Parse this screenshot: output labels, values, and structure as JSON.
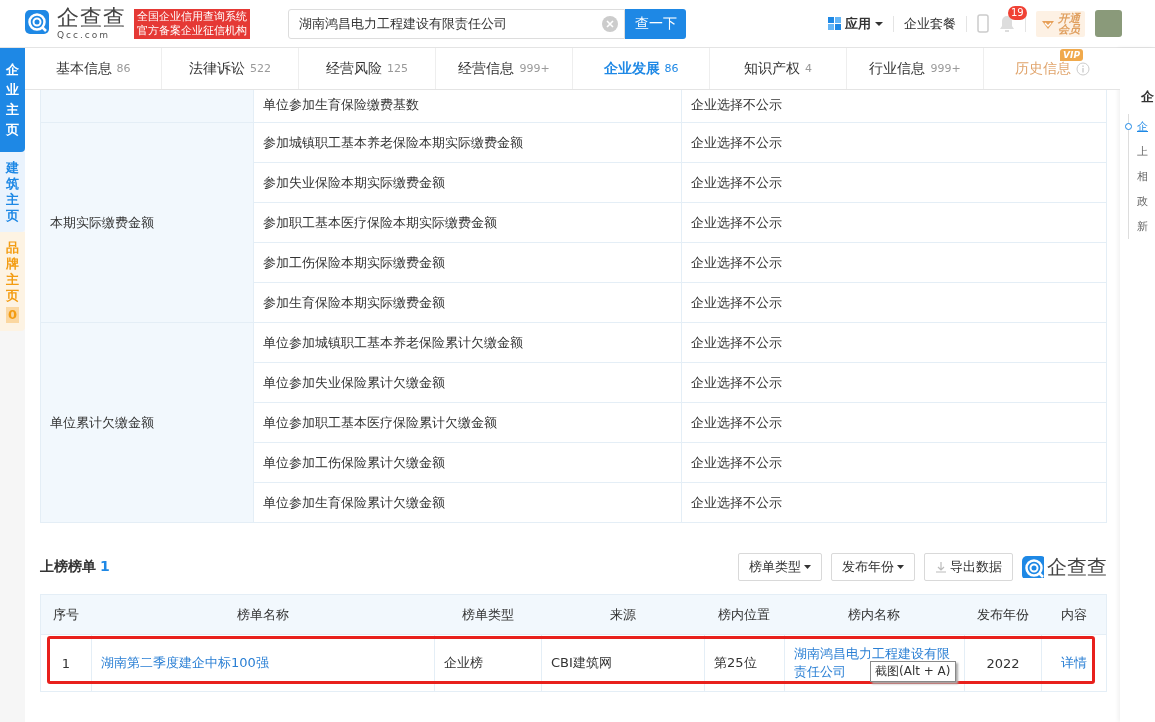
{
  "header": {
    "logo_text": "企查查",
    "logo_sub": "Qcc.com",
    "badge_lines": [
      "全国企业信用查询系统",
      "官方备案企业征信机构"
    ],
    "search": {
      "value": "湖南鸿昌电力工程建设有限责任公司"
    },
    "search_button": "查一下",
    "apps": "应用",
    "package": "企业套餐",
    "notifications": "19",
    "vip": [
      "开通",
      "会员"
    ]
  },
  "side_tabs": [
    {
      "label": "企业主页",
      "selected": true,
      "color": "#1e88e5"
    },
    {
      "label": "建筑主页",
      "selected": false,
      "color": "#1e88e5"
    },
    {
      "label": "品牌主页",
      "selected": false,
      "color": "#f39c12",
      "count": "0"
    }
  ],
  "tabs": [
    {
      "label": "基本信息",
      "count": "86",
      "selected": false,
      "kind": "normal"
    },
    {
      "label": "法律诉讼",
      "count": "522",
      "selected": false,
      "kind": "normal"
    },
    {
      "label": "经营风险",
      "count": "125",
      "selected": false,
      "kind": "normal"
    },
    {
      "label": "经营信息",
      "count": "999+",
      "selected": false,
      "kind": "normal"
    },
    {
      "label": "企业发展",
      "count": "86",
      "selected": true,
      "kind": "normal"
    },
    {
      "label": "知识产权",
      "count": "4",
      "selected": false,
      "kind": "normal"
    },
    {
      "label": "行业信息",
      "count": "999+",
      "selected": false,
      "kind": "normal"
    },
    {
      "label": "历史信息",
      "badge": "VIP",
      "selected": false,
      "kind": "vip"
    }
  ],
  "info_table": {
    "groups": [
      {
        "rows": [
          {
            "item": "单位参加生育保险缴费基数",
            "value": "企业选择不公示"
          }
        ]
      },
      {
        "label": "本期实际缴费金额",
        "rows": [
          {
            "item": "参加城镇职工基本养老保险本期实际缴费金额",
            "value": "企业选择不公示"
          },
          {
            "item": "参加失业保险本期实际缴费金额",
            "value": "企业选择不公示"
          },
          {
            "item": "参加职工基本医疗保险本期实际缴费金额",
            "value": "企业选择不公示"
          },
          {
            "item": "参加工伤保险本期实际缴费金额",
            "value": "企业选择不公示"
          },
          {
            "item": "参加生育保险本期实际缴费金额",
            "value": "企业选择不公示"
          }
        ]
      },
      {
        "label": "单位累计欠缴金额",
        "rows": [
          {
            "item": "单位参加城镇职工基本养老保险累计欠缴金额",
            "value": "企业选择不公示"
          },
          {
            "item": "单位参加失业保险累计欠缴金额",
            "value": "企业选择不公示"
          },
          {
            "item": "单位参加职工基本医疗保险累计欠缴金额",
            "value": "企业选择不公示"
          },
          {
            "item": "单位参加工伤保险累计欠缴金额",
            "value": "企业选择不公示"
          },
          {
            "item": "单位参加生育保险累计欠缴金额",
            "value": "企业选择不公示"
          }
        ]
      }
    ]
  },
  "rank": {
    "title": "上榜榜单",
    "count": "1",
    "filters": [
      "榜单类型",
      "发布年份"
    ],
    "export": "导出数据",
    "logo_text": "企查查",
    "columns": [
      "序号",
      "榜单名称",
      "榜单类型",
      "来源",
      "榜内位置",
      "榜内名称",
      "发布年份",
      "内容"
    ],
    "rows": [
      {
        "index": "1",
        "name": "湖南第二季度建企中标100强",
        "type": "企业榜",
        "source": "CBI建筑网",
        "position": "第25位",
        "listed_name": "湖南鸿昌电力工程建设有限责任公司",
        "year": "2022",
        "detail": "详情",
        "highlighted": true
      }
    ],
    "tooltip": "截图(Alt + A)"
  },
  "right_nav": {
    "title": "企",
    "items": [
      {
        "label": "企",
        "selected": true
      },
      {
        "label": "上",
        "selected": false
      },
      {
        "label": "相",
        "selected": false
      },
      {
        "label": "政",
        "selected": false
      },
      {
        "label": "新",
        "selected": false
      }
    ]
  }
}
